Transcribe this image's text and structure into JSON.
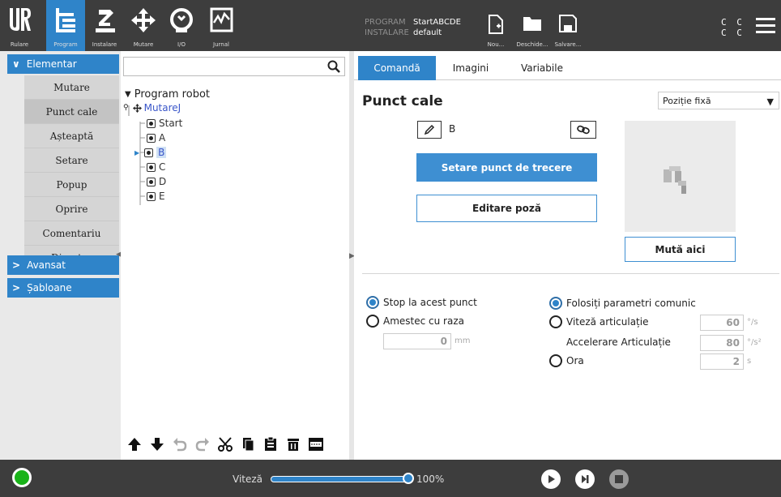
{
  "topbar": {
    "nav_buttons": [
      {
        "label": "Rulare",
        "icon": "ur-logo-icon"
      },
      {
        "label": "Program",
        "icon": "program-icon"
      },
      {
        "label": "Instalare",
        "icon": "robot-arm-icon"
      },
      {
        "label": "Mutare",
        "icon": "move-arrows-icon"
      },
      {
        "label": "I/O",
        "icon": "io-icon"
      },
      {
        "label": "Jurnal",
        "icon": "log-graph-icon"
      }
    ],
    "program_key": "PROGRAM",
    "program_value": "StartABCDE",
    "installation_key": "INSTALARE",
    "installation_value": "default",
    "file_buttons": [
      {
        "label": "Nou...",
        "icon": "new-file-icon"
      },
      {
        "label": "Deschide...",
        "icon": "open-folder-icon"
      },
      {
        "label": "Salvare...",
        "icon": "save-icon"
      }
    ],
    "cc_line1": "C C",
    "cc_line2": "C C",
    "accent": "#2f84c9"
  },
  "leftnav": {
    "basic_header": "Elementar",
    "items": [
      "Mutare",
      "Punct cale",
      "Așteaptă",
      "Setare",
      "Popup",
      "Oprire",
      "Comentariu",
      "Director"
    ],
    "active_item": "Punct cale",
    "advanced_header": "Avansat",
    "templates_header": "Șabloane"
  },
  "tree": {
    "search_placeholder": "",
    "root": "Program robot",
    "move_node": "MutareJ",
    "waypoints": [
      "Start",
      "A",
      "B",
      "C",
      "D",
      "E"
    ],
    "selected": "B"
  },
  "editor": {
    "tabs": [
      "Comandă",
      "Imagini",
      "Variabile"
    ],
    "active_tab": "Comandă",
    "title": "Punct cale",
    "waypoint_type": "Poziție fixă",
    "waypoint_name": "B",
    "set_waypoint_button": "Setare punct de trecere",
    "edit_pose_button": "Editare poză",
    "move_here_button": "Mută aici",
    "stop_here": "Stop la acest punct",
    "blend_with_radius": "Amestec cu raza",
    "blend_radius_value": "0",
    "blend_radius_unit": "mm",
    "use_shared_params": "Folosiți parametri comunic",
    "joint_speed": "Viteză articulație",
    "joint_speed_value": "60",
    "joint_speed_unit": "°/s",
    "joint_accel": "Accelerare Articulație",
    "joint_accel_value": "80",
    "joint_accel_unit": "°/s²",
    "time": "Ora",
    "time_value": "2",
    "time_unit": "s"
  },
  "bottombar": {
    "speed_label": "Viteză",
    "speed_value": "100%",
    "speed_fraction": 1.0
  }
}
